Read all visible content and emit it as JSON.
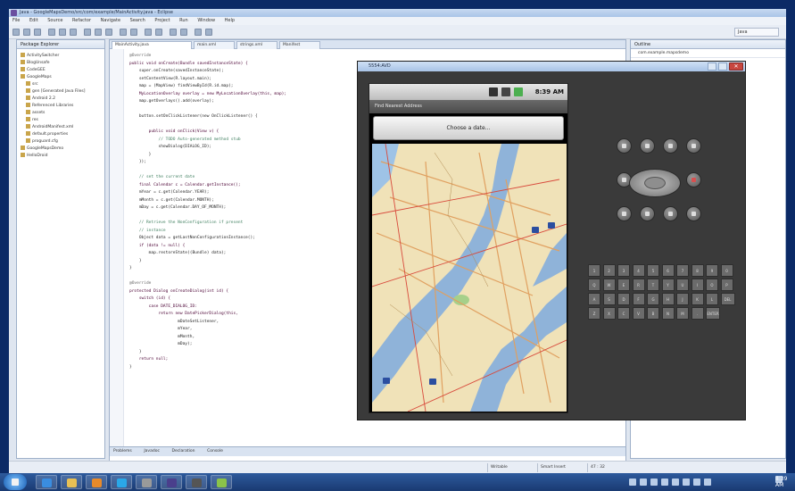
{
  "window": {
    "title": "Java - GoogleMapsDemo/src/com/example/MainActivity.java - Eclipse"
  },
  "menubar": {
    "items": [
      "File",
      "Edit",
      "Source",
      "Refactor",
      "Navigate",
      "Search",
      "Project",
      "Run",
      "Window",
      "Help"
    ]
  },
  "toolbar": {
    "perspective": "Java"
  },
  "package_explorer": {
    "tab": "Package Explorer",
    "items": [
      "ActivitySwitcher",
      "BlogUnsafe",
      "CodeGEE",
      "GoogleMaps",
      "src",
      "gen [Generated Java Files]",
      "Android 2.2",
      "Referenced Libraries",
      "assets",
      "res",
      "AndroidManifest.xml",
      "default.properties",
      "proguard.cfg",
      "GoogleMapsDemo",
      "HelloDroid"
    ]
  },
  "editor": {
    "tabs": [
      "MainActivity.java",
      "main.xml",
      "strings.xml",
      "Manifest"
    ],
    "lines": [
      "@Override",
      "public void onCreate(Bundle savedInstanceState) {",
      "    super.onCreate(savedInstanceState);",
      "    setContentView(R.layout.main);",
      "    map = (MapView) findViewById(R.id.map);",
      "    MyLocationOverlay overlay = new MyLocationOverlay(this, map);",
      "    map.getOverlays().add(overlay);",
      "",
      "    button.setOnClickListener(new OnClickListener() {",
      "",
      "        public void onClick(View v) {",
      "            // TODO Auto-generated method stub",
      "            showDialog(DIALOG_ID);",
      "        }",
      "    });",
      "",
      "    // set the current date",
      "    final Calendar c = Calendar.getInstance();",
      "    mYear = c.get(Calendar.YEAR);",
      "    mMonth = c.get(Calendar.MONTH);",
      "    mDay = c.get(Calendar.DAY_OF_MONTH);",
      "",
      "    // Retrieve the NonConfiguration if present",
      "    // instance",
      "    Object data = getLastNonConfigurationInstance();",
      "    if (data != null) {",
      "        map.restoreState((Bundle) data);",
      "    }",
      "}",
      "",
      "@Override",
      "protected Dialog onCreateDialog(int id) {",
      "    switch (id) {",
      "        case DATE_DIALOG_ID:",
      "            return new DatePickerDialog(this,",
      "                    mDateSetListener,",
      "                    mYear,",
      "                    mMonth,",
      "                    mDay);",
      "    }",
      "    return null;",
      "}"
    ]
  },
  "outline": {
    "tab": "Outline",
    "header": "com.example.mapsdemo"
  },
  "bottom_tabs": [
    "Problems",
    "Javadoc",
    "Declaration",
    "Console"
  ],
  "statusbar": {
    "mode": "Writable",
    "insert": "Smart Insert",
    "position": "47 : 32"
  },
  "emulator": {
    "title": "5554:AVD",
    "time": "8:39 AM",
    "app_title": "Find Nearest Address",
    "choose_button": "Choose a date...",
    "keys": [
      "1",
      "2",
      "3",
      "4",
      "5",
      "6",
      "7",
      "8",
      "9",
      "0",
      "Q",
      "W",
      "E",
      "R",
      "T",
      "Y",
      "U",
      "I",
      "O",
      "P",
      "A",
      "S",
      "D",
      "F",
      "G",
      "H",
      "J",
      "K",
      "L",
      "DEL",
      "Z",
      "X",
      "C",
      "V",
      "B",
      "N",
      "M",
      ".",
      "ENTER"
    ]
  },
  "taskbar": {
    "clock": "8:39 AM"
  },
  "colors": {
    "taskbar": "#1a3a72",
    "emulator_body": "#3a3a3a",
    "map_water": "#8fb3d9",
    "map_land": "#f0e2b8"
  }
}
